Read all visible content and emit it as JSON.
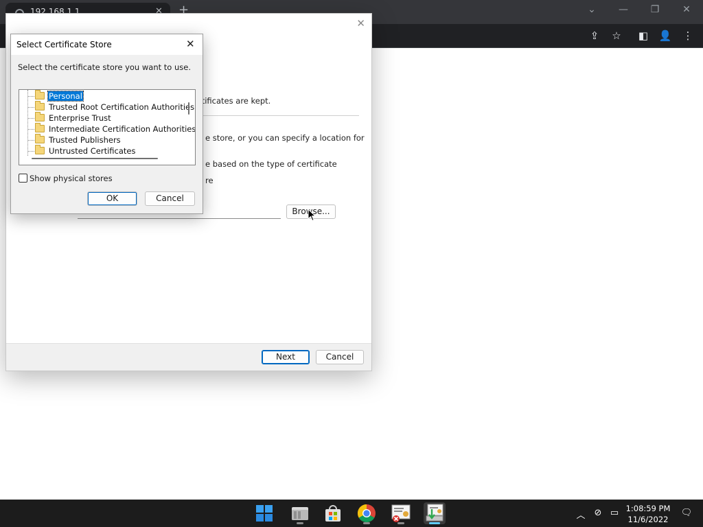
{
  "browser": {
    "tab_title": "192.168.1.1",
    "tab_close_glyph": "✕",
    "new_tab_glyph": "+",
    "tab_search_glyph": "⌄",
    "minimize_glyph": "—",
    "restore_glyph": "❐",
    "close_glyph": "✕",
    "share_glyph": "⇪",
    "bookmark_glyph": "☆",
    "sidepanel_glyph": "◧",
    "profile_glyph": "👤",
    "menu_glyph": "⋮"
  },
  "wizard": {
    "close_glyph": "✕",
    "text_kept": "rtificates are kept.",
    "text_store": "e store, or you can specify a location for",
    "text_auto": "e based on the type of certificate",
    "text_place": "re",
    "browse_label": "Browse...",
    "next_label": "Next",
    "cancel_label": "Cancel"
  },
  "select_store": {
    "title": "Select Certificate Store",
    "close_glyph": "✕",
    "instruction": "Select the certificate store you want to use.",
    "stores": [
      {
        "label": "Personal"
      },
      {
        "label": "Trusted Root Certification Authorities"
      },
      {
        "label": "Enterprise Trust"
      },
      {
        "label": "Intermediate Certification Authorities"
      },
      {
        "label": "Trusted Publishers"
      },
      {
        "label": "Untrusted Certificates"
      }
    ],
    "selected_store": "Personal",
    "show_physical_label": "Show physical stores",
    "show_physical_checked": false,
    "ok_label": "OK",
    "cancel_label": "Cancel"
  },
  "taskbar": {
    "apps": [
      {
        "name": "start",
        "icon": "windows-logo-icon"
      },
      {
        "name": "file-explorer",
        "icon": "folder-icon"
      },
      {
        "name": "microsoft-store",
        "icon": "store-bag-icon"
      },
      {
        "name": "chrome",
        "icon": "chrome-icon"
      },
      {
        "name": "certificate-manager",
        "icon": "certificate-icon"
      },
      {
        "name": "certificate-import-wizard",
        "icon": "certificate-wizard-icon",
        "active": true
      }
    ],
    "tray": {
      "chevron_glyph": "︿",
      "network_glyph": "⊘",
      "display_glyph": "▭",
      "notification_glyph": "🗨"
    },
    "time": "1:08:59 PM",
    "date": "11/6/2022"
  },
  "colors": {
    "selection": "#0078d7",
    "primary_button_border": "#0067c0",
    "taskbar_accent": "#60cdff"
  }
}
